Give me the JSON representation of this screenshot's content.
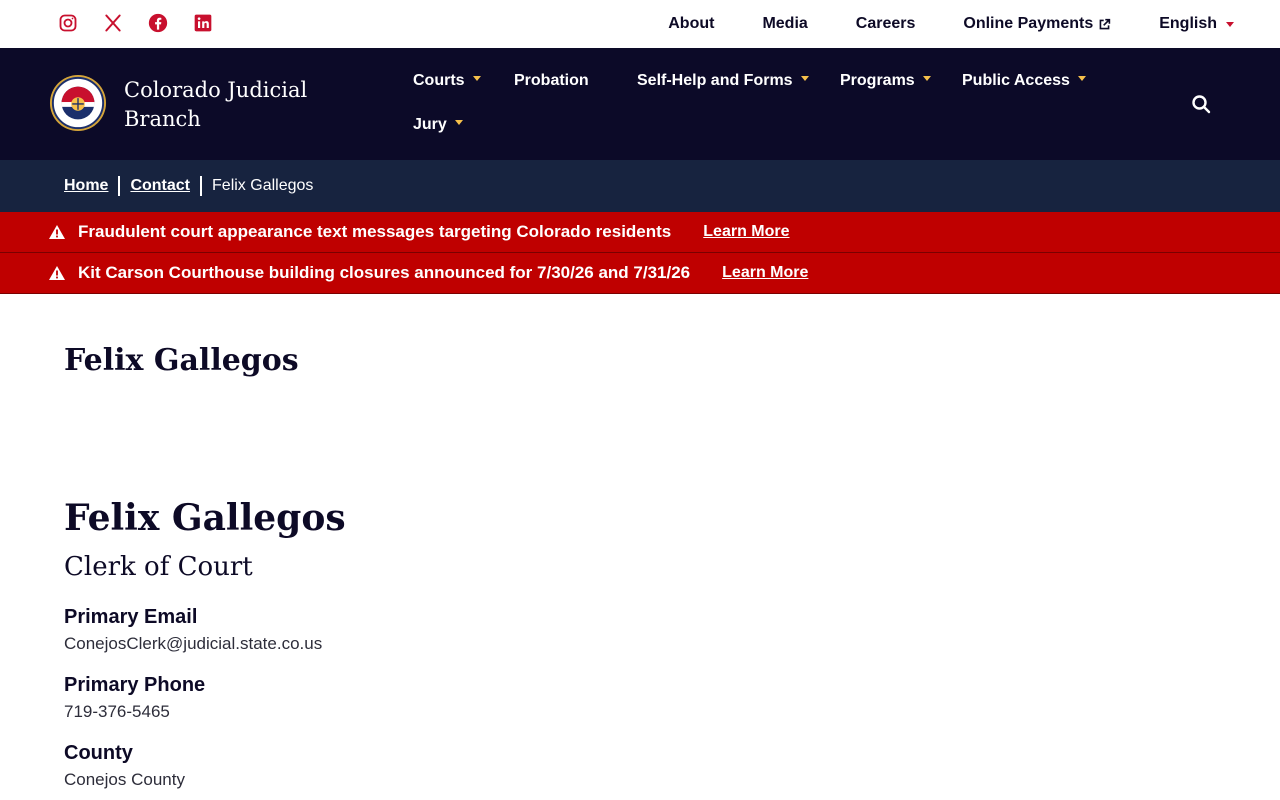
{
  "utility": {
    "social": [
      {
        "name": "instagram-icon"
      },
      {
        "name": "x-icon"
      },
      {
        "name": "facebook-icon"
      },
      {
        "name": "linkedin-icon"
      }
    ],
    "links": {
      "about": "About",
      "media": "Media",
      "careers": "Careers",
      "payments": "Online Payments",
      "language": "English"
    }
  },
  "header": {
    "brand": "Colorado Judicial Branch",
    "nav": {
      "courts": "Courts",
      "probation": "Probation",
      "self_help": "Self-Help and Forms",
      "programs": "Programs",
      "public_access": "Public Access",
      "jury": "Jury"
    }
  },
  "breadcrumb": {
    "home": "Home",
    "contact": "Contact",
    "current": "Felix Gallegos"
  },
  "alerts": [
    {
      "message": "Fraudulent court appearance text messages targeting Colorado residents",
      "link": "Learn More"
    },
    {
      "message": "Kit Carson Courthouse building closures announced for 7/30/26 and 7/31/26",
      "link": "Learn More"
    }
  ],
  "content": {
    "page_title": "Felix Gallegos",
    "name": "Felix Gallegos",
    "role": "Clerk of Court",
    "fields": [
      {
        "label": "Primary Email",
        "value": "ConejosClerk@judicial.state.co.us"
      },
      {
        "label": "Primary Phone",
        "value": "719-376-5465"
      },
      {
        "label": "County",
        "value": "Conejos County"
      }
    ]
  },
  "colors": {
    "brand_navy": "#0c0a28",
    "breadcrumb_navy": "#17233f",
    "alert_red": "#bf0000",
    "accent_gold": "#f6c04b",
    "social_red": "#c8102e"
  }
}
